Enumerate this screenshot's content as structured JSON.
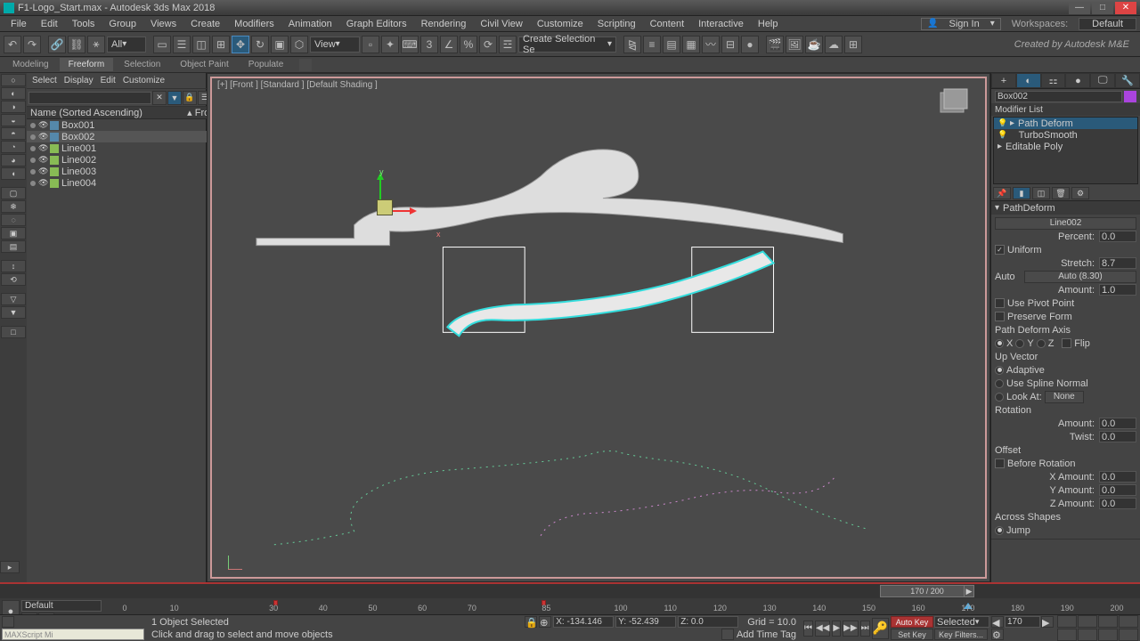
{
  "title": "F1-Logo_Start.max - Autodesk 3ds Max 2018",
  "menu": [
    "File",
    "Edit",
    "Tools",
    "Group",
    "Views",
    "Create",
    "Modifiers",
    "Animation",
    "Graph Editors",
    "Rendering",
    "Civil View",
    "Customize",
    "Scripting",
    "Content",
    "Interactive",
    "Help"
  ],
  "signin": "Sign In",
  "workspaces_label": "Workspaces:",
  "workspace": "Default",
  "credit": "Created by Autodesk M&E",
  "filter_all": "All",
  "view_dd": "View",
  "create_sel_set": "Create Selection Se",
  "ribbon": [
    "Modeling",
    "Freeform",
    "Selection",
    "Object Paint",
    "Populate"
  ],
  "ribbon_active": 1,
  "scene_tabs": [
    "Select",
    "Display",
    "Edit",
    "Customize"
  ],
  "scene_header": "Name (Sorted Ascending)",
  "scene_frozen": "Frozen",
  "scene_items": [
    "Box001",
    "Box002",
    "Line001",
    "Line002",
    "Line003",
    "Line004"
  ],
  "scene_selected": 1,
  "viewport_label": "[+] [Front ] [Standard ] [Default Shading ]",
  "gizmo": {
    "x": "x",
    "y": "y"
  },
  "object_name": "Box002",
  "modifier_list_label": "Modifier List",
  "modifiers": [
    "Path Deform",
    "TurboSmooth",
    "Editable Poly"
  ],
  "modifier_selected": 0,
  "pathdeform": {
    "title": "PathDeform",
    "spline_label": "Line002",
    "percent_label": "Percent:",
    "percent": "0.0",
    "uniform": "Uniform",
    "stretch_label": "Stretch:",
    "stretch": "8.7",
    "auto": "Auto",
    "auto_val": "Auto (8.30)",
    "amount_label": "Amount:",
    "amount": "1.0",
    "pivot": "Use Pivot Point",
    "preserve": "Preserve Form",
    "axis_label": "Path Deform Axis",
    "axes": [
      "X",
      "Y",
      "Z"
    ],
    "flip": "Flip",
    "upvector": "Up Vector",
    "adaptive": "Adaptive",
    "spline_normal": "Use Spline Normal",
    "lookat": "Look At:",
    "lookat_btn": "None",
    "rotation": "Rotation",
    "rot_amount_label": "Amount:",
    "rot_amount": "0.0",
    "twist_label": "Twist:",
    "twist": "0.0",
    "offset": "Offset",
    "before_rot": "Before Rotation",
    "x_amount_label": "X Amount:",
    "x_amount": "0.0",
    "y_amount_label": "Y Amount:",
    "y_amount": "0.0",
    "z_amount_label": "Z Amount:",
    "z_amount": "0.0",
    "across": "Across Shapes",
    "jump": "Jump"
  },
  "time_handle": "170 / 200",
  "ticks": [
    "0",
    "10",
    "30",
    "40",
    "50",
    "60",
    "70",
    "85",
    "100",
    "110",
    "120",
    "130",
    "140",
    "150",
    "160",
    "170",
    "180",
    "190",
    "200"
  ],
  "status": {
    "maxscript": "MAXScript Mi",
    "selected": "1 Object Selected",
    "prompt": "Click and drag to select and move objects",
    "x": "X: -134.146",
    "y": "Y: -52.439",
    "z": "Z: 0.0",
    "grid": "Grid = 10.0",
    "addtag": "Add Time Tag",
    "autokey": "Auto Key",
    "setkey": "Set Key",
    "selected_dd": "Selected",
    "keyfilters": "Key Filters...",
    "frame": "170"
  },
  "material": "Default"
}
